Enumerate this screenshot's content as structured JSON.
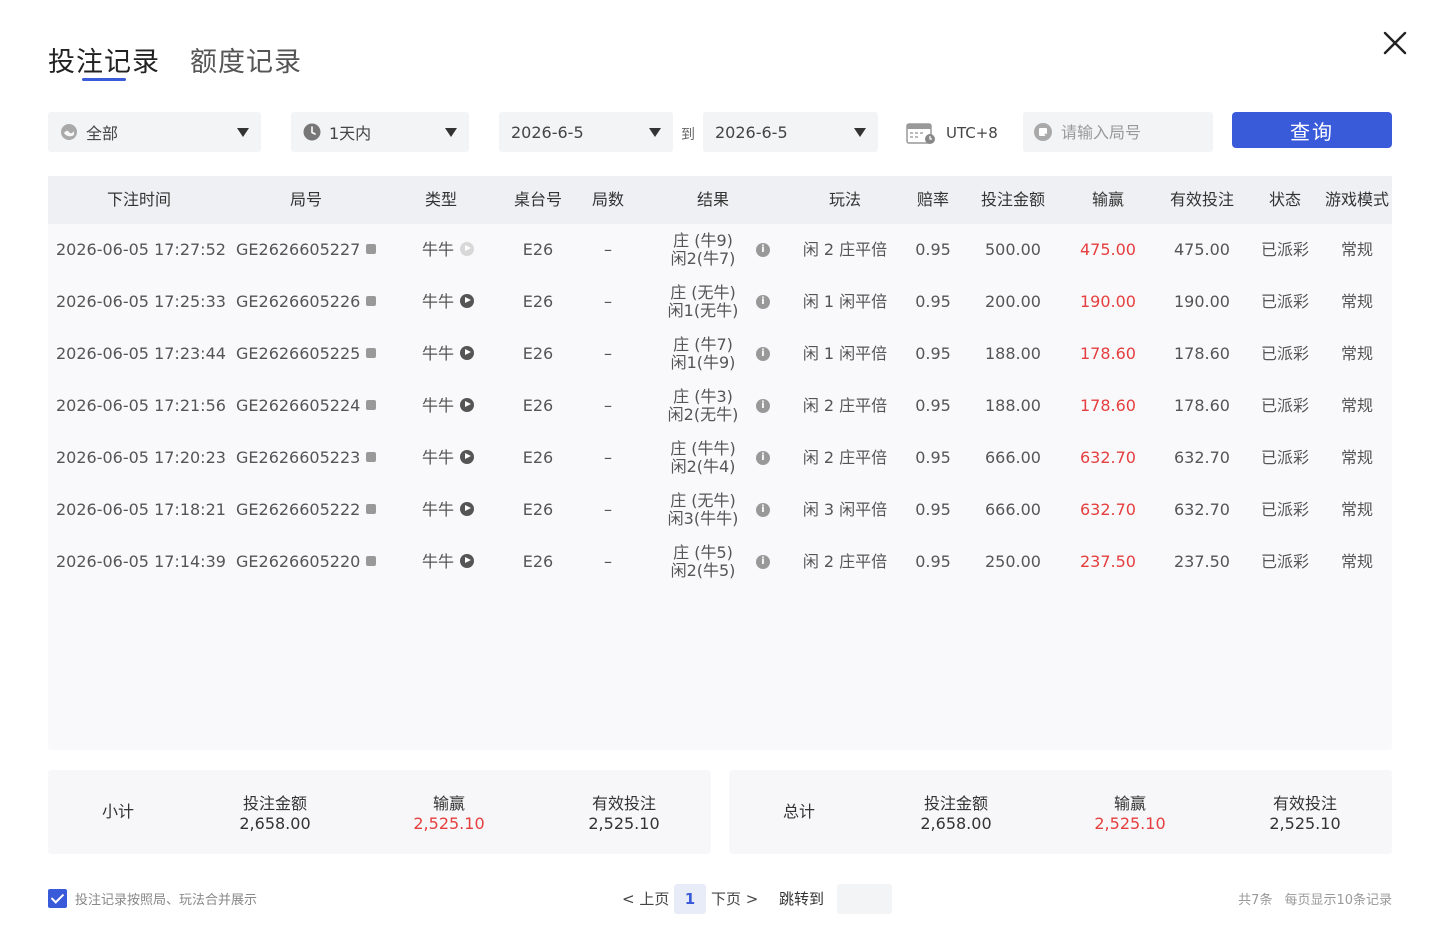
{
  "tabs": {
    "bets": "投注记录",
    "quota": "额度记录"
  },
  "filters": {
    "game": "全部",
    "range": "1天内",
    "date_from": "2026-6-5",
    "to_label": "到",
    "date_to": "2026-6-5",
    "timezone": "UTC+8",
    "round_placeholder": "请输入局号",
    "query_label": "查询"
  },
  "columns": [
    "下注时间",
    "局号",
    "类型",
    "桌台号",
    "局数",
    "结果",
    "玩法",
    "赔率",
    "投注金额",
    "输赢",
    "有效投注",
    "状态",
    "游戏模式"
  ],
  "rows": [
    {
      "time": "2026-06-05 17:27:52",
      "round": "GE2626605227",
      "type": "牛牛",
      "table": "E26",
      "count": "–",
      "result1": "庄 (牛9)",
      "result2": "闲2(牛7)",
      "play": "闲 2 庄平倍",
      "odds": "0.95",
      "amount": "500.00",
      "win": "475.00",
      "valid": "475.00",
      "status": "已派彩",
      "mode": "常规"
    },
    {
      "time": "2026-06-05 17:25:33",
      "round": "GE2626605226",
      "type": "牛牛",
      "table": "E26",
      "count": "–",
      "result1": "庄 (无牛)",
      "result2": "闲1(无牛)",
      "play": "闲 1 闲平倍",
      "odds": "0.95",
      "amount": "200.00",
      "win": "190.00",
      "valid": "190.00",
      "status": "已派彩",
      "mode": "常规"
    },
    {
      "time": "2026-06-05 17:23:44",
      "round": "GE2626605225",
      "type": "牛牛",
      "table": "E26",
      "count": "–",
      "result1": "庄 (牛7)",
      "result2": "闲1(牛9)",
      "play": "闲 1 闲平倍",
      "odds": "0.95",
      "amount": "188.00",
      "win": "178.60",
      "valid": "178.60",
      "status": "已派彩",
      "mode": "常规"
    },
    {
      "time": "2026-06-05 17:21:56",
      "round": "GE2626605224",
      "type": "牛牛",
      "table": "E26",
      "count": "–",
      "result1": "庄 (牛3)",
      "result2": "闲2(无牛)",
      "play": "闲 2 庄平倍",
      "odds": "0.95",
      "amount": "188.00",
      "win": "178.60",
      "valid": "178.60",
      "status": "已派彩",
      "mode": "常规"
    },
    {
      "time": "2026-06-05 17:20:23",
      "round": "GE2626605223",
      "type": "牛牛",
      "table": "E26",
      "count": "–",
      "result1": "庄 (牛牛)",
      "result2": "闲2(牛4)",
      "play": "闲 2 庄平倍",
      "odds": "0.95",
      "amount": "666.00",
      "win": "632.70",
      "valid": "632.70",
      "status": "已派彩",
      "mode": "常规"
    },
    {
      "time": "2026-06-05 17:18:21",
      "round": "GE2626605222",
      "type": "牛牛",
      "table": "E26",
      "count": "–",
      "result1": "庄 (无牛)",
      "result2": "闲3(牛牛)",
      "play": "闲 3 闲平倍",
      "odds": "0.95",
      "amount": "666.00",
      "win": "632.70",
      "valid": "632.70",
      "status": "已派彩",
      "mode": "常规"
    },
    {
      "time": "2026-06-05 17:14:39",
      "round": "GE2626605220",
      "type": "牛牛",
      "table": "E26",
      "count": "–",
      "result1": "庄 (牛5)",
      "result2": "闲2(牛5)",
      "play": "闲 2 庄平倍",
      "odds": "0.95",
      "amount": "250.00",
      "win": "237.50",
      "valid": "237.50",
      "status": "已派彩",
      "mode": "常规"
    }
  ],
  "subtotal": {
    "title": "小计",
    "amount_label": "投注金额",
    "amount": "2,658.00",
    "win_label": "输赢",
    "win": "2,525.10",
    "valid_label": "有效投注",
    "valid": "2,525.10"
  },
  "total": {
    "title": "总计",
    "amount_label": "投注金额",
    "amount": "2,658.00",
    "win_label": "输赢",
    "win": "2,525.10",
    "valid_label": "有效投注",
    "valid": "2,525.10"
  },
  "footer": {
    "merge_label": "投注记录按照局、玩法合并展示",
    "prev": "< 上页",
    "current_page": "1",
    "next": "下页 >",
    "jump_label": "跳转到",
    "total_count": "共7条",
    "per_page": "每页显示10条记录"
  },
  "colors": {
    "accent": "#3a5bd9",
    "win": "#e53e3e"
  },
  "icons": {
    "close": "close-icon",
    "globe": "globe-icon",
    "clock": "clock-icon",
    "calendar": "calendar-icon",
    "search": "search-icon",
    "copy": "copy-icon",
    "play": "play-icon",
    "info": "info-icon"
  }
}
